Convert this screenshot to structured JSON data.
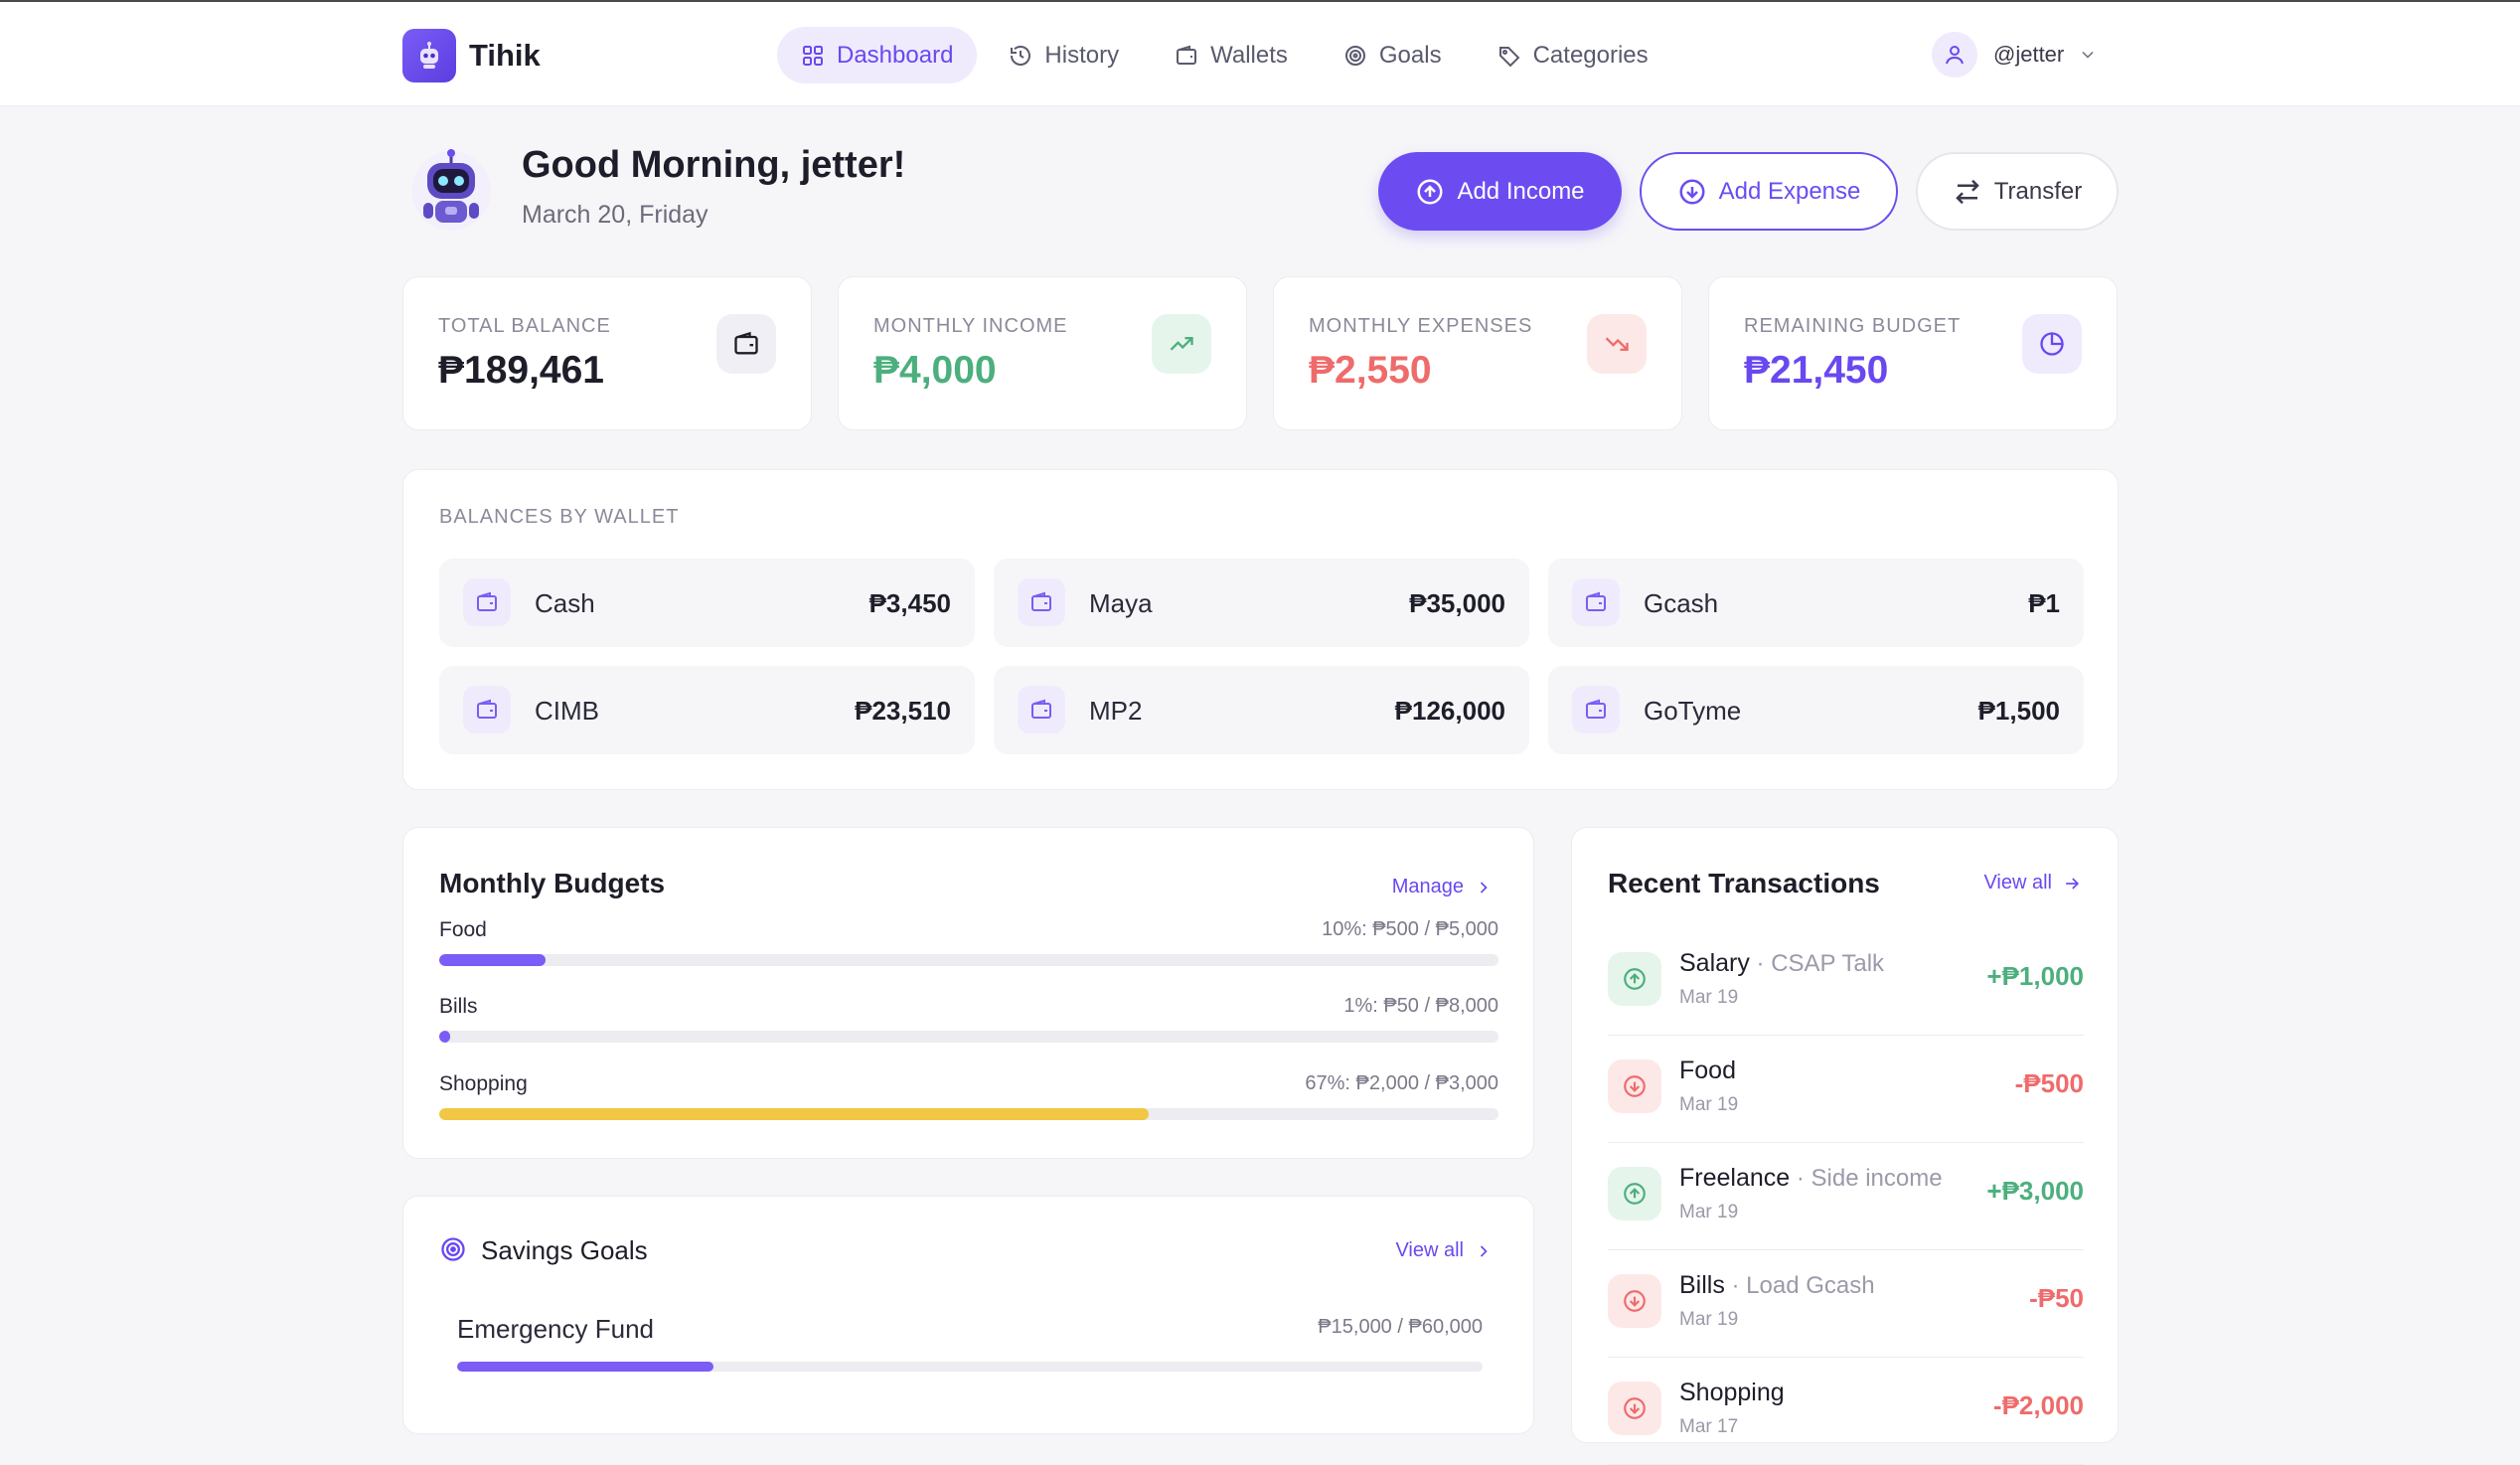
{
  "brand": {
    "name": "Tihik",
    "logo_icon": "robot-icon"
  },
  "nav": [
    {
      "label": "Dashboard",
      "icon": "grid-icon",
      "active": true
    },
    {
      "label": "History",
      "icon": "history-icon",
      "active": false
    },
    {
      "label": "Wallets",
      "icon": "wallet-icon",
      "active": false
    },
    {
      "label": "Goals",
      "icon": "target-icon",
      "active": false
    },
    {
      "label": "Categories",
      "icon": "tag-icon",
      "active": false
    }
  ],
  "user": {
    "handle": "@jetter",
    "icon": "user-icon"
  },
  "greeting": {
    "title": "Good Morning, jetter!",
    "date": "March 20, Friday"
  },
  "actions": {
    "add_income": "Add Income",
    "add_expense": "Add Expense",
    "transfer": "Transfer"
  },
  "stats": [
    {
      "label": "TOTAL BALANCE",
      "value": "₱189,461",
      "icon": "wallet-icon",
      "color": "#1e1e2a"
    },
    {
      "label": "MONTHLY INCOME",
      "value": "₱4,000",
      "icon": "trend-up-icon",
      "color": "#4caf7d"
    },
    {
      "label": "MONTHLY EXPENSES",
      "value": "₱2,550",
      "icon": "trend-down-icon",
      "color": "#ef6b6b"
    },
    {
      "label": "REMAINING BUDGET",
      "value": "₱21,450",
      "icon": "pie-chart-icon",
      "color": "#6a48f0"
    }
  ],
  "wallets": {
    "title": "BALANCES BY WALLET",
    "items": [
      {
        "name": "Cash",
        "amount": "₱3,450"
      },
      {
        "name": "Maya",
        "amount": "₱35,000"
      },
      {
        "name": "Gcash",
        "amount": "₱1"
      },
      {
        "name": "CIMB",
        "amount": "₱23,510"
      },
      {
        "name": "MP2",
        "amount": "₱126,000"
      },
      {
        "name": "GoTyme",
        "amount": "₱1,500"
      }
    ]
  },
  "budgets": {
    "title": "Monthly Budgets",
    "manage": "Manage",
    "items": [
      {
        "name": "Food",
        "meta": "10%: ₱500 / ₱5,000",
        "percent": 10,
        "color": "#7b5cf6"
      },
      {
        "name": "Bills",
        "meta": "1%: ₱50 / ₱8,000",
        "percent": 1,
        "color": "#7b5cf6"
      },
      {
        "name": "Shopping",
        "meta": "67%: ₱2,000 / ₱3,000",
        "percent": 67,
        "color": "#f2c744"
      }
    ]
  },
  "savings": {
    "title": "Savings Goals",
    "view_all": "View all",
    "goals": [
      {
        "name": "Emergency Fund",
        "meta": "₱15,000 / ₱60,000",
        "percent": 25
      }
    ]
  },
  "transactions": {
    "title": "Recent Transactions",
    "view_all": "View all",
    "items": [
      {
        "name": "Salary",
        "note": " · CSAP Talk",
        "date": "Mar 19",
        "amount": "+₱1,000",
        "type": "income"
      },
      {
        "name": "Food",
        "note": "",
        "date": "Mar 19",
        "amount": "-₱500",
        "type": "expense"
      },
      {
        "name": "Freelance",
        "note": " · Side income",
        "date": "Mar 19",
        "amount": "+₱3,000",
        "type": "income"
      },
      {
        "name": "Bills",
        "note": " · Load Gcash",
        "date": "Mar 19",
        "amount": "-₱50",
        "type": "expense"
      },
      {
        "name": "Shopping",
        "note": "",
        "date": "Mar 17",
        "amount": "-₱2,000",
        "type": "expense"
      }
    ]
  },
  "colors": {
    "accent": "#6c4cf1",
    "income": "#4caf7d",
    "expense": "#ef6b6b",
    "warning": "#f2c744"
  }
}
